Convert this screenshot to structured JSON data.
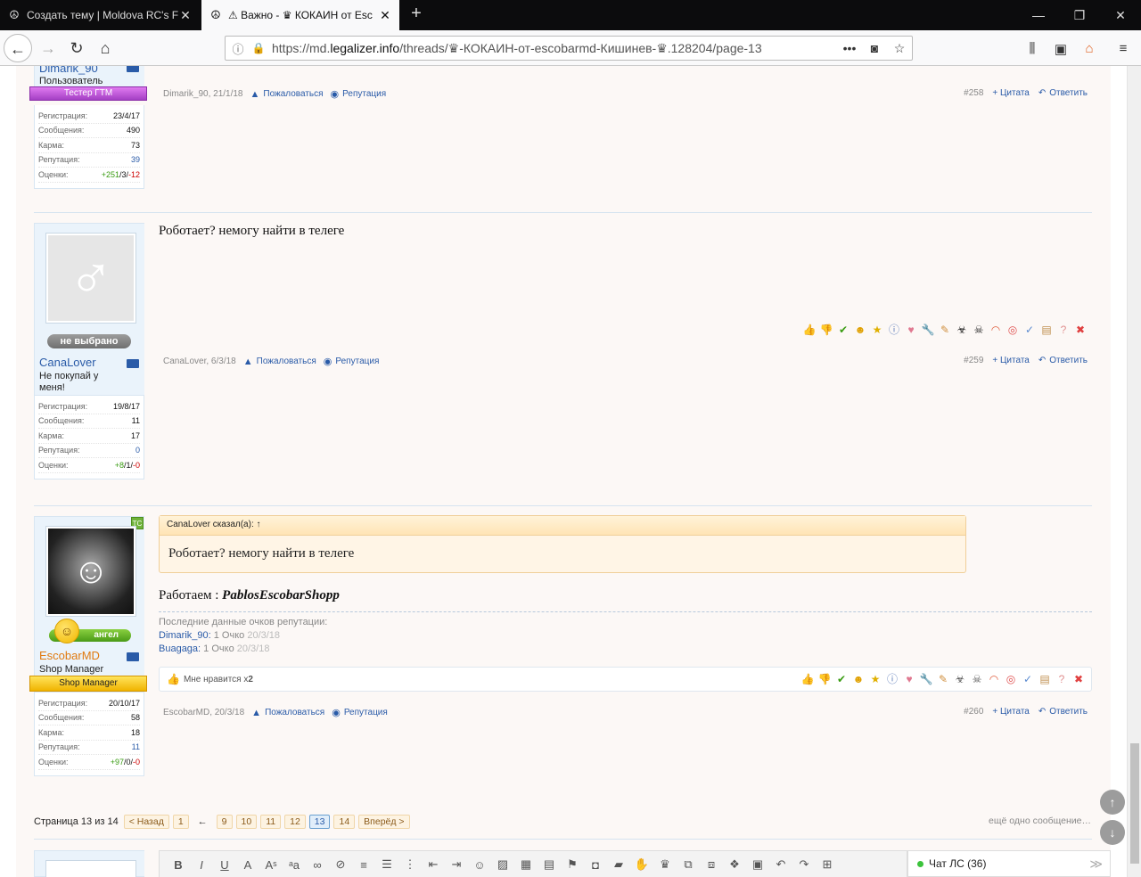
{
  "browser": {
    "tabs": [
      {
        "icon": "peace-icon",
        "title": "Создать тему | Moldova RC's F"
      },
      {
        "icon": "peace-icon",
        "title": "⚠ Важно - ♛ КОКАИН от Esc"
      }
    ],
    "url_prefix": "https://md.",
    "url_domain": "legalizer.info",
    "url_path": "/threads/♛-КОКАИН-от-escobarmd-Кишинев-♛.128204/page-13",
    "url_more": "•••"
  },
  "post258": {
    "username": "Dimarik_90",
    "user_title": "Пользователь",
    "user_badge": "Тестер ГТМ",
    "stats": [
      {
        "k": "Регистрация:",
        "v": "23/4/17"
      },
      {
        "k": "Сообщения:",
        "v": "490"
      },
      {
        "k": "Карма:",
        "v": "73"
      },
      {
        "k": "Репутация:",
        "v": "39"
      }
    ],
    "ratings_label": "Оценки:",
    "ratings_pos": "+251",
    "ratings_mid": "/3/",
    "ratings_neg": "-12",
    "meta_author": "Dimarik_90, 21/1/18",
    "report": "Пожаловаться",
    "reputation": "Репутация",
    "num": "#258",
    "quote": "+ Цитата",
    "reply": "Ответить"
  },
  "post259": {
    "username": "CanaLover",
    "user_title": "Не покупай у меня!",
    "gender_badge": "не выбрано",
    "text": "Роботает? немогу найти в телеге",
    "stats": [
      {
        "k": "Регистрация:",
        "v": "19/8/17"
      },
      {
        "k": "Сообщения:",
        "v": "11"
      },
      {
        "k": "Карма:",
        "v": "17"
      },
      {
        "k": "Репутация:",
        "v": "0"
      }
    ],
    "ratings_label": "Оценки:",
    "ratings_pos": "+8",
    "ratings_mid": "/1/",
    "ratings_neg": "-0",
    "meta_author": "CanaLover, 6/3/18",
    "report": "Пожаловаться",
    "reputation": "Репутация",
    "num": "#259",
    "quote": "+ Цитата",
    "reply": "Ответить"
  },
  "post260": {
    "username": "EscobarMD",
    "user_title": "Shop Manager",
    "user_badge": "Shop Manager",
    "angel_badge": "ангел",
    "tc_badge": "ТС",
    "quote_header": "CanaLover сказал(а): ↑",
    "quote_text": "Роботает? немогу найти в телеге",
    "text_prefix": "Работаем : ",
    "text_bold": "PablosEscobarShopp",
    "rep_title": "Последние данные очков репутации:",
    "rep_entries": [
      {
        "user": "Dimarik_90:",
        "points": " 1 Очко ",
        "date": "20/3/18"
      },
      {
        "user": "Buagaga:",
        "points": " 1 Очко ",
        "date": "20/3/18"
      }
    ],
    "likes_text": "Мне нравится x ",
    "likes_count": "2",
    "stats": [
      {
        "k": "Регистрация:",
        "v": "20/10/17"
      },
      {
        "k": "Сообщения:",
        "v": "58"
      },
      {
        "k": "Карма:",
        "v": "18"
      },
      {
        "k": "Репутация:",
        "v": "11"
      }
    ],
    "ratings_label": "Оценки:",
    "ratings_pos": "+97",
    "ratings_mid": "/0/",
    "ratings_neg": "-0",
    "meta_author": "EscobarMD, 20/3/18",
    "report": "Пожаловаться",
    "reputation": "Репутация",
    "num": "#260",
    "quote": "+ Цитата",
    "reply": "Ответить"
  },
  "pager": {
    "label": "Страница 13 из 14",
    "prev": "< Назад",
    "pages": [
      "1",
      "9",
      "10",
      "11",
      "12",
      "13",
      "14"
    ],
    "current": "13",
    "ellipsis": "←",
    "next": "Вперёд >",
    "another": "ещё одно сообщение…"
  },
  "chat": {
    "label": "Чат ЛС (36)"
  },
  "colors": {
    "accent": "#2a5ba8",
    "page_bg": "#fcf8f6",
    "shop_manager": "#f0b300"
  }
}
